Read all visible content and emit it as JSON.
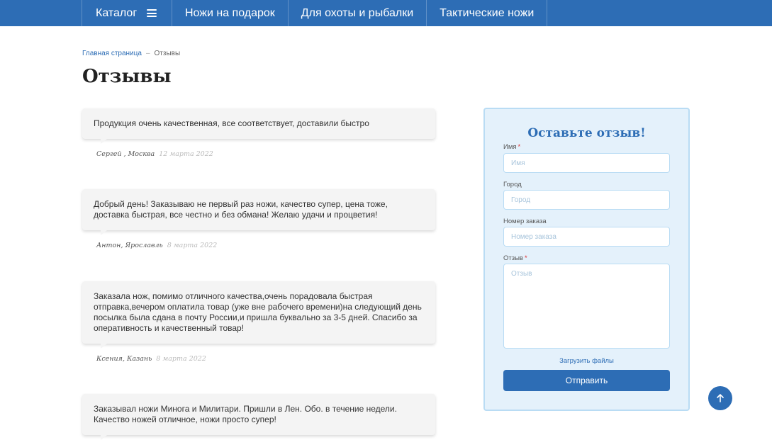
{
  "nav": {
    "catalog_label": "Каталог",
    "items": [
      {
        "label": "Ножи на подарок"
      },
      {
        "label": "Для охоты и рыбалки"
      },
      {
        "label": "Тактические ножи"
      }
    ]
  },
  "breadcrumb": {
    "home": "Главная страница",
    "separator": "–",
    "current": "Отзывы"
  },
  "page_title": "Отзывы",
  "reviews": [
    {
      "text": "Продукция очень качественная, все соответствует, доставили быстро",
      "author": "Сергей , Москва",
      "date": "12 марта 2022"
    },
    {
      "text": "Добрый день! Заказываю не первый раз ножи, качество супер, цена тоже, доставка быстрая, все честно и без обмана! Желаю удачи и процветия!",
      "author": "Антон, Ярославль",
      "date": "8 марта 2022"
    },
    {
      "text": "Заказала нож, помимо отличного качества,очень порадовала быстрая отправка,вечером оплатила товар (уже вне рабочего времени)на следующий день посылка была сдана в почту России,и пришла буквально за 3-5 дней. Спасибо за оперативность и качественный товар!",
      "author": "Ксения, Казань",
      "date": "8 марта 2022"
    },
    {
      "text": "Заказывал ножи Минога и Милитари. Пришли в Лен. Обо. в течение недели. Качество ножей отличное, ножи просто супер!",
      "author": "",
      "date": ""
    }
  ],
  "form": {
    "title": "Оставьте отзыв!",
    "name_label": "Имя",
    "name_placeholder": "Имя",
    "city_label": "Город",
    "city_placeholder": "Город",
    "order_label": "Номер заказа",
    "order_placeholder": "Номер заказа",
    "review_label": "Отзыв",
    "review_placeholder": "Отзыв",
    "required_mark": "*",
    "upload_label": "Загрузить файлы",
    "submit_label": "Отправить"
  },
  "colors": {
    "primary": "#2d6db5",
    "form_bg": "#e4f1fb"
  },
  "icons": {
    "catalog": "menu-icon",
    "scroll_top": "arrow-up-icon"
  }
}
